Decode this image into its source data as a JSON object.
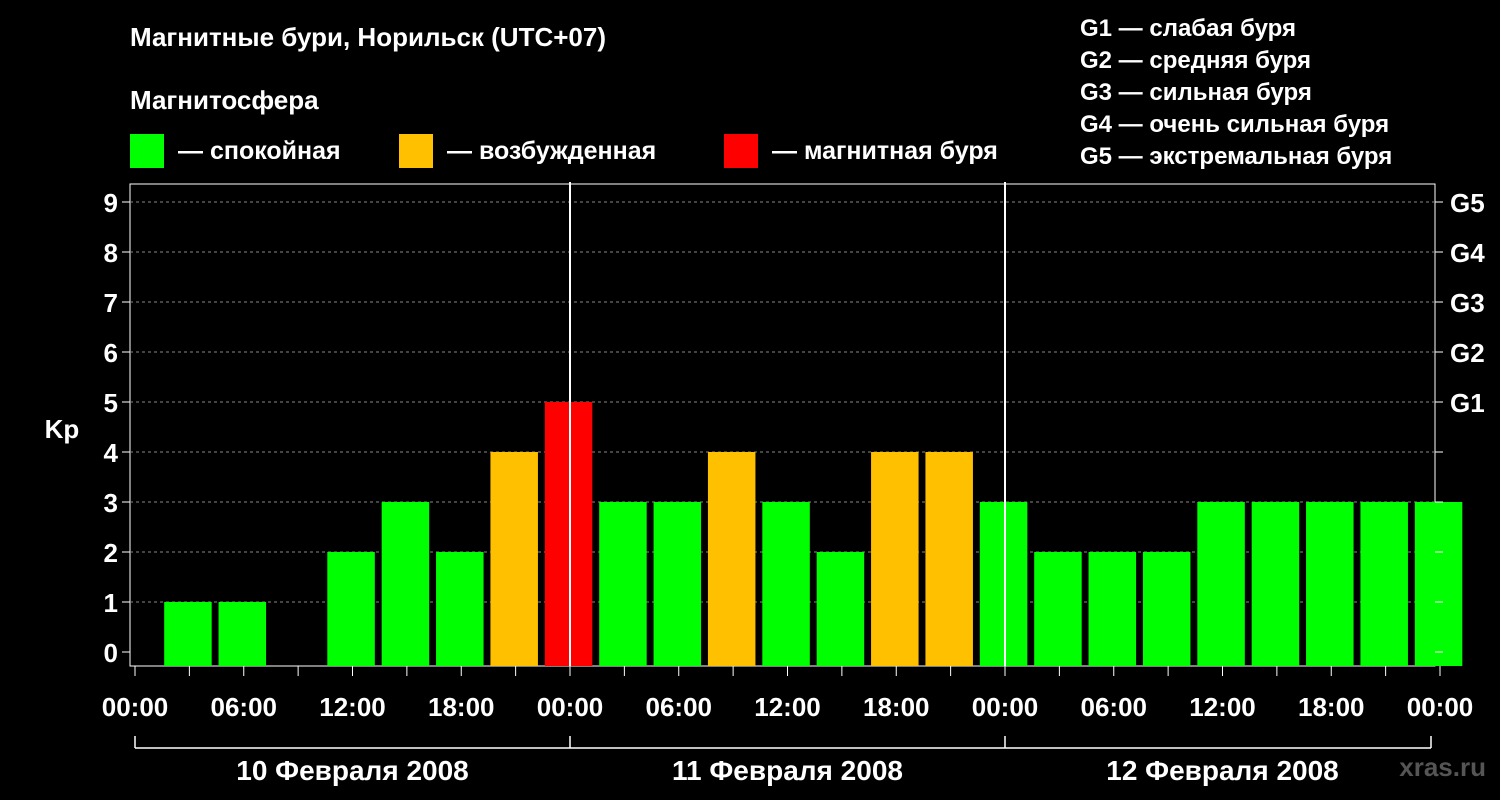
{
  "title": "Магнитные бури, Норильск (UTC+07)",
  "subtitle": "Магнитосфера",
  "legend": [
    {
      "label": "— спокойная",
      "color": "#00ff00"
    },
    {
      "label": "— возбужденная",
      "color": "#ffc000"
    },
    {
      "label": "— магнитная буря",
      "color": "#ff0000"
    }
  ],
  "g_legend": [
    "G1 — слабая буря",
    "G2 — средняя буря",
    "G3 — сильная буря",
    "G4 — очень сильная буря",
    "G5 — экстремальная буря"
  ],
  "watermark": "xras.ru",
  "chart_data": {
    "type": "bar",
    "ylabel": "Kp",
    "ylim": [
      0,
      9
    ],
    "yticks": [
      "0",
      "1",
      "2",
      "3",
      "4",
      "5",
      "6",
      "7",
      "8",
      "9"
    ],
    "right_ticks": [
      {
        "y": 5,
        "label": "G1"
      },
      {
        "y": 6,
        "label": "G2"
      },
      {
        "y": 7,
        "label": "G3"
      },
      {
        "y": 8,
        "label": "G4"
      },
      {
        "y": 9,
        "label": "G5"
      }
    ],
    "xtick_labels": [
      "00:00",
      "06:00",
      "12:00",
      "18:00",
      "00:00",
      "06:00",
      "12:00",
      "18:00",
      "00:00",
      "06:00",
      "12:00",
      "18:00",
      "00:00"
    ],
    "days": [
      "10 Февраля 2008",
      "11 Февраля 2008",
      "12 Февраля 2008"
    ],
    "intervals_per_day": 8,
    "values": [
      0,
      1,
      1,
      0,
      2,
      3,
      2,
      4,
      5,
      3,
      3,
      4,
      3,
      2,
      4,
      4,
      3,
      2,
      2,
      2,
      3,
      3,
      3,
      3,
      3
    ],
    "categories": [
      "quiet",
      "quiet",
      "quiet",
      "quiet",
      "quiet",
      "quiet",
      "quiet",
      "active",
      "storm",
      "quiet",
      "quiet",
      "active",
      "quiet",
      "quiet",
      "active",
      "active",
      "quiet",
      "quiet",
      "quiet",
      "quiet",
      "quiet",
      "quiet",
      "quiet",
      "quiet",
      "quiet"
    ],
    "colors": {
      "quiet": "#00ff00",
      "active": "#ffc000",
      "storm": "#ff0000"
    },
    "grid": true
  }
}
